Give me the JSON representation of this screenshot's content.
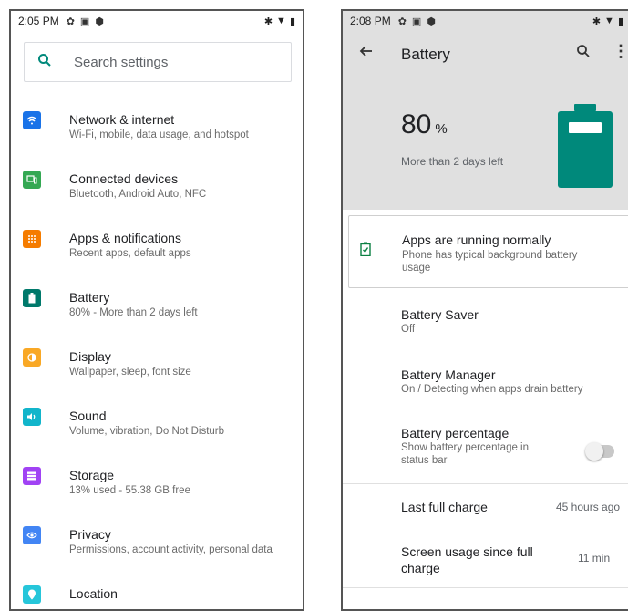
{
  "left": {
    "status": {
      "time": "2:05 PM"
    },
    "search": {
      "placeholder": "Search settings"
    },
    "items": [
      {
        "title": "Network & internet",
        "subtitle": "Wi-Fi, mobile, data usage, and hotspot",
        "icon": "wifi-icon",
        "color": "#1a73e8"
      },
      {
        "title": "Connected devices",
        "subtitle": "Bluetooth, Android Auto, NFC",
        "icon": "devices-icon",
        "color": "#34a853"
      },
      {
        "title": "Apps & notifications",
        "subtitle": "Recent apps, default apps",
        "icon": "apps-icon",
        "color": "#f57c00"
      },
      {
        "title": "Battery",
        "subtitle": "80% - More than 2 days left",
        "icon": "battery-icon",
        "color": "#00796b"
      },
      {
        "title": "Display",
        "subtitle": "Wallpaper, sleep, font size",
        "icon": "display-icon",
        "color": "#f9a825"
      },
      {
        "title": "Sound",
        "subtitle": "Volume, vibration, Do Not Disturb",
        "icon": "sound-icon",
        "color": "#12b5cb"
      },
      {
        "title": "Storage",
        "subtitle": "13% used - 55.38 GB free",
        "icon": "storage-icon",
        "color": "#a142f4"
      },
      {
        "title": "Privacy",
        "subtitle": "Permissions, account activity, personal data",
        "icon": "privacy-icon",
        "color": "#4285f4"
      },
      {
        "title": "Location",
        "subtitle": "",
        "icon": "location-icon",
        "color": "#26c6da"
      }
    ]
  },
  "right": {
    "status": {
      "time": "2:08 PM"
    },
    "title": "Battery",
    "header": {
      "percent": "80",
      "unit": "%",
      "estimate": "More than 2 days left"
    },
    "tip": {
      "title": "Apps are running normally",
      "summary": "Phone has typical background battery usage"
    },
    "saver": {
      "title": "Battery Saver",
      "subtitle": "Off"
    },
    "manager": {
      "title": "Battery Manager",
      "subtitle": "On / Detecting when apps drain battery"
    },
    "percentage": {
      "title": "Battery percentage",
      "subtitle": "Show battery percentage in status bar",
      "enabled": false
    },
    "last_charge": {
      "title": "Last full charge",
      "value": "45 hours ago"
    },
    "screen_usage": {
      "title": "Screen usage since full charge",
      "value": "11 min"
    }
  },
  "colors": {
    "accent": "#00897b",
    "battery": "#00897b"
  }
}
